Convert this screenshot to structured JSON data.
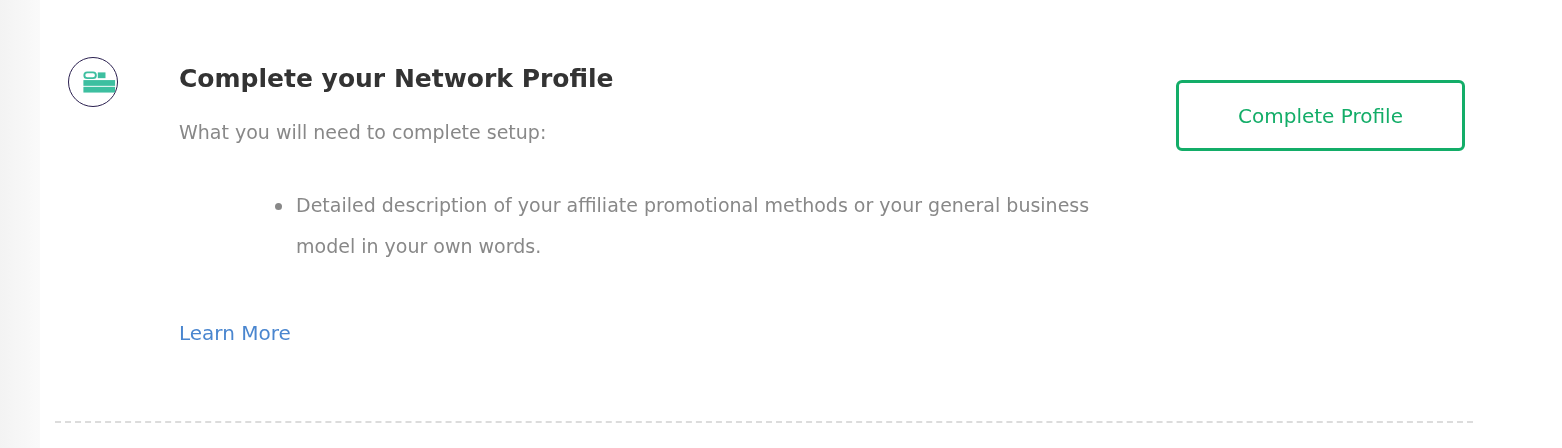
{
  "task": {
    "title": "Complete your Network Profile",
    "subtitle": "What you will need to complete setup:",
    "requirements": [
      "Detailed description of your affiliate promotional methods or your general business model in your own words."
    ],
    "link": "Learn More",
    "button": "Complete Profile"
  }
}
